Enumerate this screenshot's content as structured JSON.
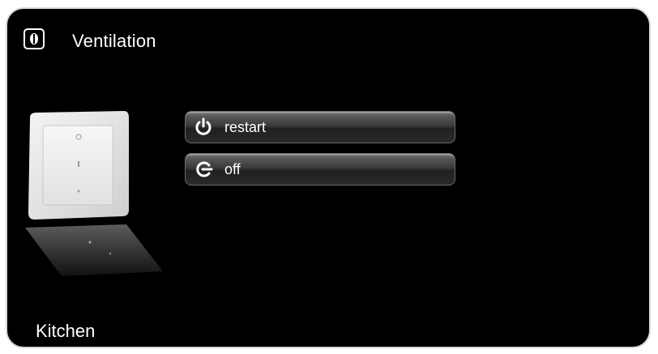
{
  "header": {
    "title": "Ventilation",
    "icon": "fan-icon"
  },
  "actions": [
    {
      "label": "restart",
      "icon": "power-icon"
    },
    {
      "label": "off",
      "icon": "power-off-icon"
    }
  ],
  "device": {
    "icon": "wall-switch-image"
  },
  "footer": {
    "location": "Kitchen"
  },
  "colors": {
    "background": "#000000",
    "border": "#d9d9d9",
    "text": "#ffffff",
    "button": "#3a3a3a"
  }
}
